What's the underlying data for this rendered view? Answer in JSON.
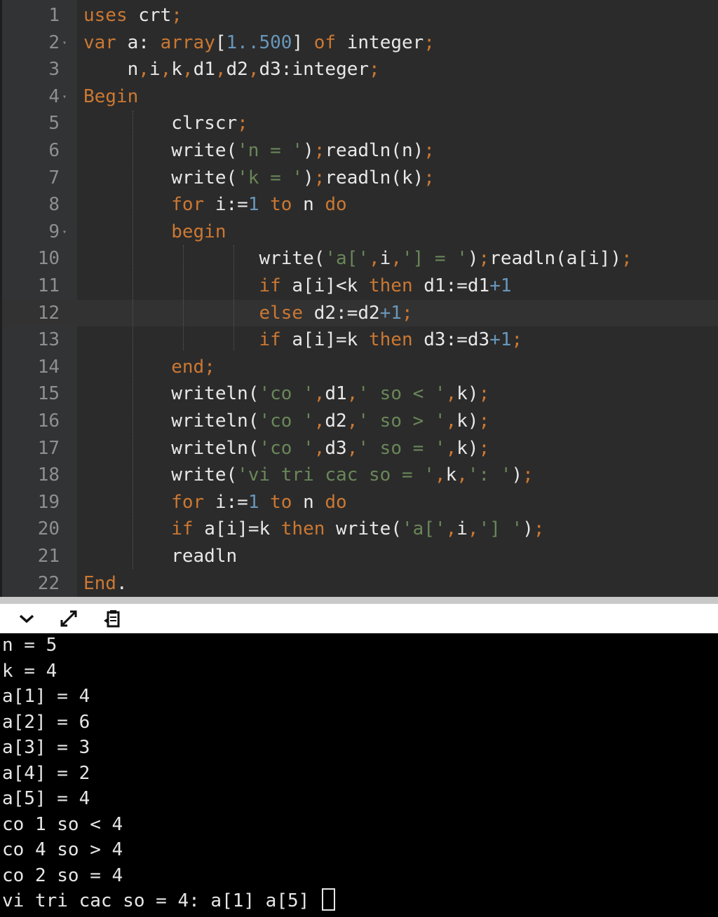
{
  "editor": {
    "current_line": 12,
    "lines": [
      {
        "n": "1",
        "parts": [
          [
            "kw",
            "uses"
          ],
          [
            "id",
            " crt"
          ],
          [
            "punc",
            ";"
          ]
        ]
      },
      {
        "n": "2",
        "fold": true,
        "parts": [
          [
            "kw",
            "var"
          ],
          [
            "id",
            " a: "
          ],
          [
            "kw",
            "array"
          ],
          [
            "id",
            "["
          ],
          [
            "num",
            "1..500"
          ],
          [
            "id",
            "] "
          ],
          [
            "kw",
            "of"
          ],
          [
            "id",
            " integer"
          ],
          [
            "punc",
            ";"
          ]
        ]
      },
      {
        "n": "3",
        "parts": [
          [
            "id",
            "    n"
          ],
          [
            "punc",
            ","
          ],
          [
            "id",
            "i"
          ],
          [
            "punc",
            ","
          ],
          [
            "id",
            "k"
          ],
          [
            "punc",
            ","
          ],
          [
            "id",
            "d1"
          ],
          [
            "punc",
            ","
          ],
          [
            "id",
            "d2"
          ],
          [
            "punc",
            ","
          ],
          [
            "id",
            "d3:integer"
          ],
          [
            "punc",
            ";"
          ]
        ]
      },
      {
        "n": "4",
        "fold": true,
        "parts": [
          [
            "kw",
            "Begin"
          ]
        ]
      },
      {
        "n": "5",
        "parts": [
          [
            "id",
            "        clrscr"
          ],
          [
            "punc",
            ";"
          ]
        ]
      },
      {
        "n": "6",
        "parts": [
          [
            "id",
            "        write("
          ],
          [
            "str",
            "'n = '"
          ],
          [
            "id",
            ")"
          ],
          [
            "punc",
            ";"
          ],
          [
            "id",
            "readln(n)"
          ],
          [
            "punc",
            ";"
          ]
        ]
      },
      {
        "n": "7",
        "parts": [
          [
            "id",
            "        write("
          ],
          [
            "str",
            "'k = '"
          ],
          [
            "id",
            ")"
          ],
          [
            "punc",
            ";"
          ],
          [
            "id",
            "readln(k)"
          ],
          [
            "punc",
            ";"
          ]
        ]
      },
      {
        "n": "8",
        "parts": [
          [
            "kw",
            "        for"
          ],
          [
            "id",
            " i:="
          ],
          [
            "num",
            "1"
          ],
          [
            "kw",
            " to"
          ],
          [
            "id",
            " n "
          ],
          [
            "kw",
            "do"
          ]
        ]
      },
      {
        "n": "9",
        "fold": true,
        "parts": [
          [
            "kw",
            "        begin"
          ]
        ]
      },
      {
        "n": "10",
        "parts": [
          [
            "id",
            "                write("
          ],
          [
            "str",
            "'a['"
          ],
          [
            "punc",
            ","
          ],
          [
            "id",
            "i"
          ],
          [
            "punc",
            ","
          ],
          [
            "str",
            "'] = '"
          ],
          [
            "id",
            ")"
          ],
          [
            "punc",
            ";"
          ],
          [
            "id",
            "readln(a[i])"
          ],
          [
            "punc",
            ";"
          ]
        ]
      },
      {
        "n": "11",
        "parts": [
          [
            "kw",
            "                if"
          ],
          [
            "id",
            " a[i]<k "
          ],
          [
            "kw",
            "then"
          ],
          [
            "id",
            " d1:=d1"
          ],
          [
            "num",
            "+1"
          ]
        ]
      },
      {
        "n": "12",
        "parts": [
          [
            "kw",
            "                else"
          ],
          [
            "id",
            " d2:=d2"
          ],
          [
            "num",
            "+1"
          ],
          [
            "punc",
            ";"
          ]
        ]
      },
      {
        "n": "13",
        "parts": [
          [
            "kw",
            "                if"
          ],
          [
            "id",
            " a[i]=k "
          ],
          [
            "kw",
            "then"
          ],
          [
            "id",
            " d3:=d3"
          ],
          [
            "num",
            "+1"
          ],
          [
            "punc",
            ";"
          ]
        ]
      },
      {
        "n": "14",
        "parts": [
          [
            "kw",
            "        end"
          ],
          [
            "punc",
            ";"
          ]
        ]
      },
      {
        "n": "15",
        "parts": [
          [
            "id",
            "        writeln("
          ],
          [
            "str",
            "'co '"
          ],
          [
            "punc",
            ","
          ],
          [
            "id",
            "d1"
          ],
          [
            "punc",
            ","
          ],
          [
            "str",
            "' so < '"
          ],
          [
            "punc",
            ","
          ],
          [
            "id",
            "k)"
          ],
          [
            "punc",
            ";"
          ]
        ]
      },
      {
        "n": "16",
        "parts": [
          [
            "id",
            "        writeln("
          ],
          [
            "str",
            "'co '"
          ],
          [
            "punc",
            ","
          ],
          [
            "id",
            "d2"
          ],
          [
            "punc",
            ","
          ],
          [
            "str",
            "' so > '"
          ],
          [
            "punc",
            ","
          ],
          [
            "id",
            "k)"
          ],
          [
            "punc",
            ";"
          ]
        ]
      },
      {
        "n": "17",
        "parts": [
          [
            "id",
            "        writeln("
          ],
          [
            "str",
            "'co '"
          ],
          [
            "punc",
            ","
          ],
          [
            "id",
            "d3"
          ],
          [
            "punc",
            ","
          ],
          [
            "str",
            "' so = '"
          ],
          [
            "punc",
            ","
          ],
          [
            "id",
            "k)"
          ],
          [
            "punc",
            ";"
          ]
        ]
      },
      {
        "n": "18",
        "parts": [
          [
            "id",
            "        write("
          ],
          [
            "str",
            "'vi tri cac so = '"
          ],
          [
            "punc",
            ","
          ],
          [
            "id",
            "k"
          ],
          [
            "punc",
            ","
          ],
          [
            "str",
            "': '"
          ],
          [
            "id",
            ")"
          ],
          [
            "punc",
            ";"
          ]
        ]
      },
      {
        "n": "19",
        "parts": [
          [
            "kw",
            "        for"
          ],
          [
            "id",
            " i:="
          ],
          [
            "num",
            "1"
          ],
          [
            "kw",
            " to"
          ],
          [
            "id",
            " n "
          ],
          [
            "kw",
            "do"
          ]
        ]
      },
      {
        "n": "20",
        "parts": [
          [
            "kw",
            "        if"
          ],
          [
            "id",
            " a[i]=k "
          ],
          [
            "kw",
            "then"
          ],
          [
            "id",
            " write("
          ],
          [
            "str",
            "'a['"
          ],
          [
            "punc",
            ","
          ],
          [
            "id",
            "i"
          ],
          [
            "punc",
            ","
          ],
          [
            "str",
            "'] '"
          ],
          [
            "id",
            ")"
          ],
          [
            "punc",
            ";"
          ]
        ]
      },
      {
        "n": "21",
        "parts": [
          [
            "id",
            "        readln"
          ]
        ]
      },
      {
        "n": "22",
        "parts": [
          [
            "kw",
            "End"
          ],
          [
            "id",
            "."
          ]
        ]
      }
    ]
  },
  "toolbar": {
    "icons": [
      "chevron-down-icon",
      "expand-icon",
      "clipboard-icon"
    ]
  },
  "console": {
    "lines": [
      "n = 5",
      "k = 4",
      "a[1] = 4",
      "a[2] = 6",
      "a[3] = 3",
      "a[4] = 2",
      "a[5] = 4",
      "co 1 so < 4",
      "co 4 so > 4",
      "co 2 so = 4",
      "vi tri cac so = 4: a[1] a[5] "
    ]
  }
}
